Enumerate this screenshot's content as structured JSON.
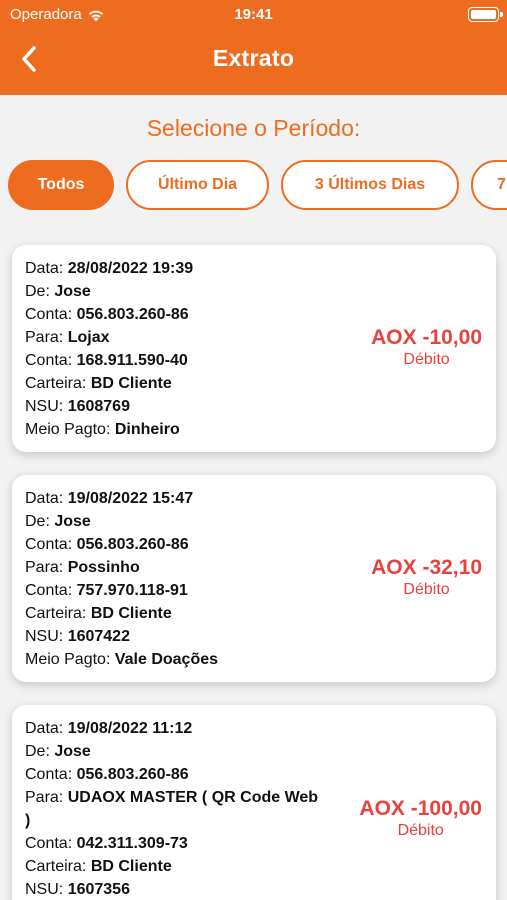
{
  "status_bar": {
    "carrier": "Operadora",
    "time": "19:41"
  },
  "header": {
    "title": "Extrato"
  },
  "period": {
    "label": "Selecione o Período:",
    "chips": [
      "Todos",
      "Último Dia",
      "3 Últimos Dias",
      "7"
    ],
    "selected": "Todos"
  },
  "labels": {
    "data": "Data:",
    "de": "De:",
    "conta": "Conta:",
    "para": "Para:",
    "carteira": "Carteira:",
    "nsu": "NSU:",
    "meio": "Meio Pagto:"
  },
  "transactions": [
    {
      "data": "28/08/2022 19:39",
      "de": "Jose",
      "conta_origem": "056.803.260-86",
      "para": "Lojax",
      "conta_destino": "168.911.590-40",
      "carteira": "BD Cliente",
      "nsu": "1608769",
      "meio_pagto": "Dinheiro",
      "valor": "AOX -10,00",
      "tipo": "Débito"
    },
    {
      "data": "19/08/2022 15:47",
      "de": "Jose",
      "conta_origem": "056.803.260-86",
      "para": "Possinho",
      "conta_destino": "757.970.118-91",
      "carteira": "BD Cliente",
      "nsu": "1607422",
      "meio_pagto": "Vale Doações",
      "valor": "AOX -32,10",
      "tipo": "Débito"
    },
    {
      "data": "19/08/2022 11:12",
      "de": "Jose",
      "conta_origem": "056.803.260-86",
      "para": "UDAOX MASTER ( QR Code Web )",
      "conta_destino": "042.311.309-73",
      "carteira": "BD Cliente",
      "nsu": "1607356",
      "valor": "AOX -100,00",
      "tipo": "Débito"
    }
  ],
  "colors": {
    "accent": "#ee6c1f",
    "debit": "#e5433c",
    "background": "#f2f2f2"
  },
  "icons": {
    "back": "chevron-left-icon",
    "wifi": "wifi-icon",
    "battery": "battery-icon"
  }
}
